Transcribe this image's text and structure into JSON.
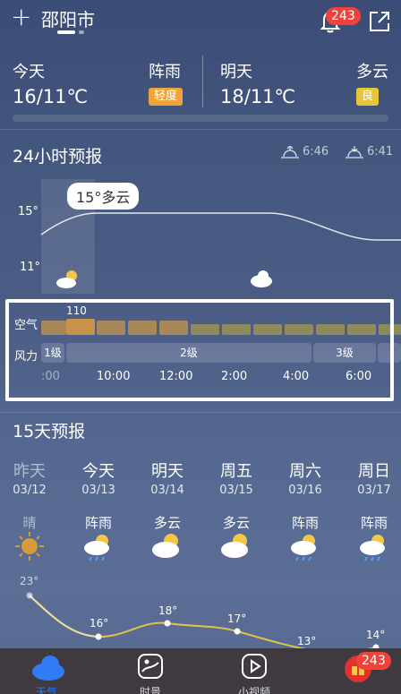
{
  "header": {
    "city": "邵阳市",
    "notification_count": "243"
  },
  "today": {
    "label": "今天",
    "temp": "16/11℃",
    "weather": "阵雨",
    "aqi_tag": "轻度"
  },
  "tomorrow": {
    "label": "明天",
    "temp": "18/11℃",
    "weather": "多云",
    "aqi_tag": "良"
  },
  "hourly": {
    "title": "24小时预报",
    "sunrise": "6:46",
    "sunset": "6:41",
    "tooltip": "15°多云",
    "temp_hi_label": "15°",
    "temp_lo_label": "11°",
    "air_label": "空气",
    "air_value": "110",
    "wind_label": "风力",
    "wind_segments": [
      "1级",
      "2级",
      "3级"
    ],
    "times": [
      ":00",
      "10:00",
      "12:00",
      "2:00",
      "4:00",
      "6:00"
    ]
  },
  "daily": {
    "title": "15天预报",
    "days": [
      {
        "name": "昨天",
        "date": "03/12",
        "cond": "晴",
        "high": "23°",
        "low": ""
      },
      {
        "name": "今天",
        "date": "03/13",
        "cond": "阵雨",
        "high": "16°",
        "low": ""
      },
      {
        "name": "明天",
        "date": "03/14",
        "cond": "多云",
        "high": "18°",
        "low": ""
      },
      {
        "name": "周五",
        "date": "03/15",
        "cond": "多云",
        "high": "17°",
        "low": ""
      },
      {
        "name": "周六",
        "date": "03/16",
        "cond": "阵雨",
        "high": "13°",
        "low": ""
      },
      {
        "name": "周日",
        "date": "03/17",
        "cond": "阵雨",
        "high": "14°",
        "low": ""
      }
    ]
  },
  "nav": {
    "weather": "天气",
    "moments": "时景",
    "video": "小视频",
    "badge": "243"
  },
  "colors": {
    "accent": "#2f7cf6",
    "badge": "#f0423b",
    "tag_orange": "#f0a33a",
    "tag_yellow": "#e7c53a"
  }
}
